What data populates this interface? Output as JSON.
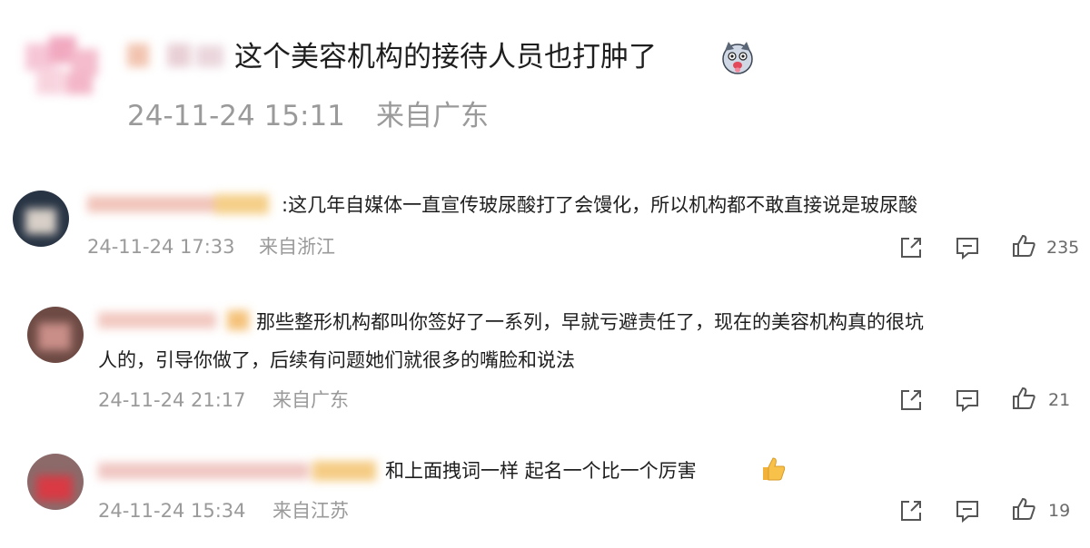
{
  "post": {
    "content": "这个美容机构的接待人员也打肿了",
    "emoji": "dog-face-emoji",
    "timestamp": "24-11-24 15:11",
    "location": "来自广东"
  },
  "comments": [
    {
      "content": ":这几年自媒体一直宣传玻尿酸打了会馒化，所以机构都不敢直接说是玻尿酸",
      "timestamp": "24-11-24 17:33",
      "location": "来自浙江",
      "likes": "235"
    },
    {
      "content_line1": "那些整形机构都叫你签好了一系列，早就亏避责任了，现在的美容机构真的很坑",
      "content_line2": "人的，引导你做了，后续有问题她们就很多的嘴脸和说法",
      "timestamp": "24-11-24 21:17",
      "location": "来自广东",
      "likes": "21"
    },
    {
      "content": "和上面拽词一样  起名一个比一个厉害",
      "emoji": "thumbs-up-emoji",
      "timestamp": "24-11-24 15:34",
      "location": "来自江苏",
      "likes": "19"
    }
  ],
  "icons": [
    "share-icon",
    "comment-icon",
    "like-icon"
  ],
  "colors": {
    "meta": "#9a9a9a",
    "text": "#1e1e1e",
    "icon": "#555555"
  }
}
